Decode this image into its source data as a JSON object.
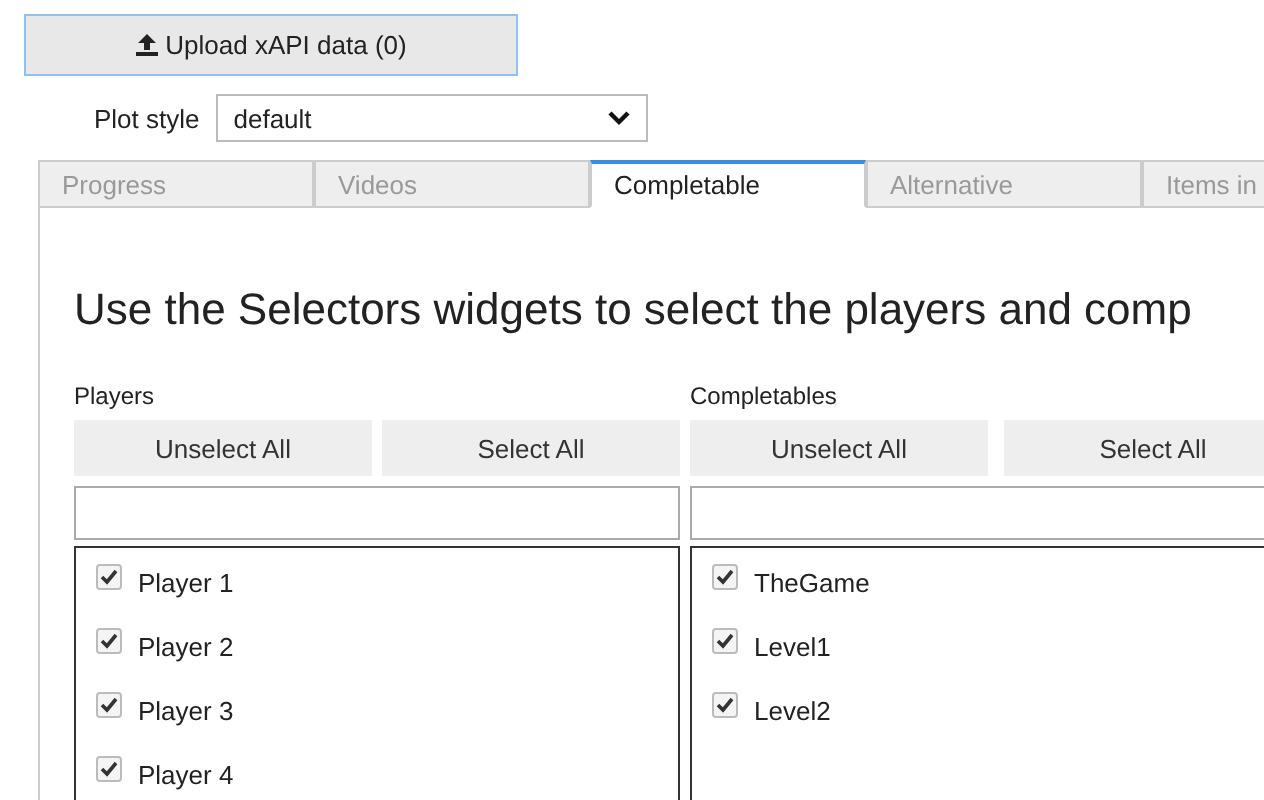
{
  "upload_button": {
    "label": "Upload xAPI data (0)"
  },
  "plot_style": {
    "label": "Plot style",
    "value": "default"
  },
  "tabs": [
    {
      "label": "Progress",
      "selected": false
    },
    {
      "label": "Videos",
      "selected": false
    },
    {
      "label": "Completable",
      "selected": true
    },
    {
      "label": "Alternative",
      "selected": false
    },
    {
      "label": "Items in",
      "selected": false
    }
  ],
  "heading": "Use the Selectors widgets to select the players and comp",
  "selectors": [
    {
      "title": "Players",
      "unselect_label": "Unselect All",
      "select_label": "Select All",
      "items": [
        {
          "label": "Player 1",
          "checked": true
        },
        {
          "label": "Player 2",
          "checked": true
        },
        {
          "label": "Player 3",
          "checked": true
        },
        {
          "label": "Player 4",
          "checked": true
        }
      ]
    },
    {
      "title": "Completables",
      "unselect_label": "Unselect All",
      "select_label": "Select All",
      "items": [
        {
          "label": "TheGame",
          "checked": true
        },
        {
          "label": "Level1",
          "checked": true
        },
        {
          "label": "Level2",
          "checked": true
        }
      ]
    }
  ]
}
